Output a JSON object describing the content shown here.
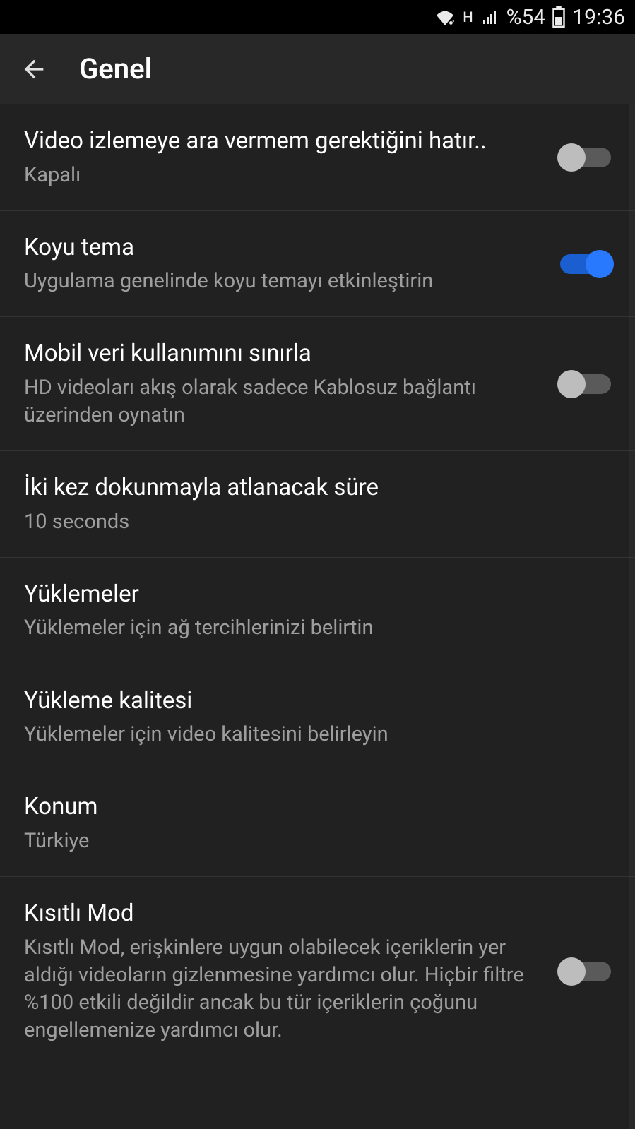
{
  "status": {
    "network_badge": "H",
    "battery_text": "%54",
    "time": "19:36"
  },
  "header": {
    "title": "Genel"
  },
  "settings": [
    {
      "title": "Video izlemeye ara vermem gerektiğini hatır..",
      "subtitle": "Kapalı",
      "toggle": "off"
    },
    {
      "title": "Koyu tema",
      "subtitle": "Uygulama genelinde koyu temayı etkinleştirin",
      "toggle": "on"
    },
    {
      "title": "Mobil veri kullanımını sınırla",
      "subtitle": "HD videoları akış olarak sadece Kablosuz bağlantı üzerinden oynatın",
      "toggle": "off"
    },
    {
      "title": "İki kez dokunmayla atlanacak süre",
      "subtitle": "10 seconds",
      "toggle": null
    },
    {
      "title": "Yüklemeler",
      "subtitle": "Yüklemeler için ağ tercihlerinizi belirtin",
      "toggle": null
    },
    {
      "title": "Yükleme kalitesi",
      "subtitle": "Yüklemeler için video kalitesini belirleyin",
      "toggle": null
    },
    {
      "title": "Konum",
      "subtitle": "Türkiye",
      "toggle": null
    },
    {
      "title": "Kısıtlı Mod",
      "subtitle": "Kısıtlı Mod, erişkinlere uygun olabilecek içeriklerin yer aldığı videoların gizlenmesine yardımcı olur. Hiçbir filtre %100 etkili değildir ancak bu tür içeriklerin çoğunu engellemenize yardımcı olur.",
      "toggle": "off"
    }
  ]
}
